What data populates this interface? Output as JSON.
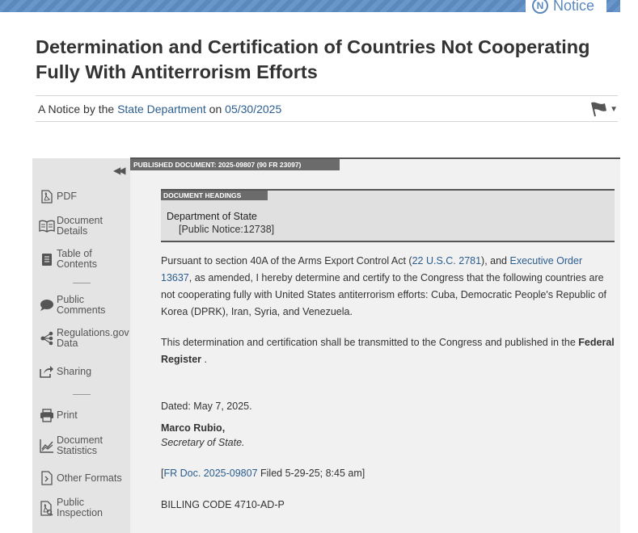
{
  "banner": {
    "badge_letter": "N",
    "badge_label": "Notice",
    "accent_color": "#5b89be"
  },
  "document": {
    "title": "Determination and Certification of Countries Not Cooperating Fully With Antiterrorism Efforts",
    "meta_prefix": "A Notice by the ",
    "agency_link": "State Department",
    "meta_on": " on ",
    "date_link": "05/30/2025"
  },
  "sidebar": {
    "collapse_glyph": "◀◀",
    "items": [
      {
        "label": "PDF",
        "icon": "pdf-icon"
      },
      {
        "label": "Document Details",
        "icon": "book-icon"
      },
      {
        "label": "Table of Contents",
        "icon": "toc-icon"
      },
      {
        "label": "Public Comments",
        "icon": "comment-icon"
      },
      {
        "label": "Regulations.gov Data",
        "icon": "share-nodes-icon"
      },
      {
        "label": "Sharing",
        "icon": "share-icon"
      },
      {
        "label": "Print",
        "icon": "print-icon"
      },
      {
        "label": "Document Statistics",
        "icon": "chart-icon"
      },
      {
        "label": "Other Formats",
        "icon": "code-file-icon"
      },
      {
        "label": "Public Inspection",
        "icon": "inspection-icon"
      }
    ]
  },
  "published": {
    "label": "PUBLISHED DOCUMENT: 2025-09807 (90 FR 23097)"
  },
  "headings": {
    "tag": "DOCUMENT HEADINGS",
    "agency": "Department of State",
    "notice_id": "[Public Notice:12738]"
  },
  "body": {
    "p1_a": "Pursuant to section 40A of the Arms Export Control Act (",
    "p1_link1": "22 U.S.C. 2781",
    "p1_b": "), and ",
    "p1_link2": "Executive Order 13637",
    "p1_c": ", as amended, I hereby determine and certify to the Congress that the following countries are not cooperating fully with United States antiterrorism efforts: Cuba, Democratic People's Republic of Korea (DPRK), Iran, Syria, and Venezuela.",
    "p2_a": "This determination and certification shall be transmitted to the Congress and published in the ",
    "p2_bold": "Federal Register",
    "p2_b": " .",
    "dated": "Dated: May 7, 2025.",
    "signer": "Marco Rubio,",
    "signer_title": "Secretary of State.",
    "frdoc_open": "[",
    "frdoc_link": "FR Doc. 2025-09807",
    "frdoc_rest": " Filed 5-29-25; 8:45 am]",
    "billing": "BILLING CODE 4710-AD-P"
  }
}
